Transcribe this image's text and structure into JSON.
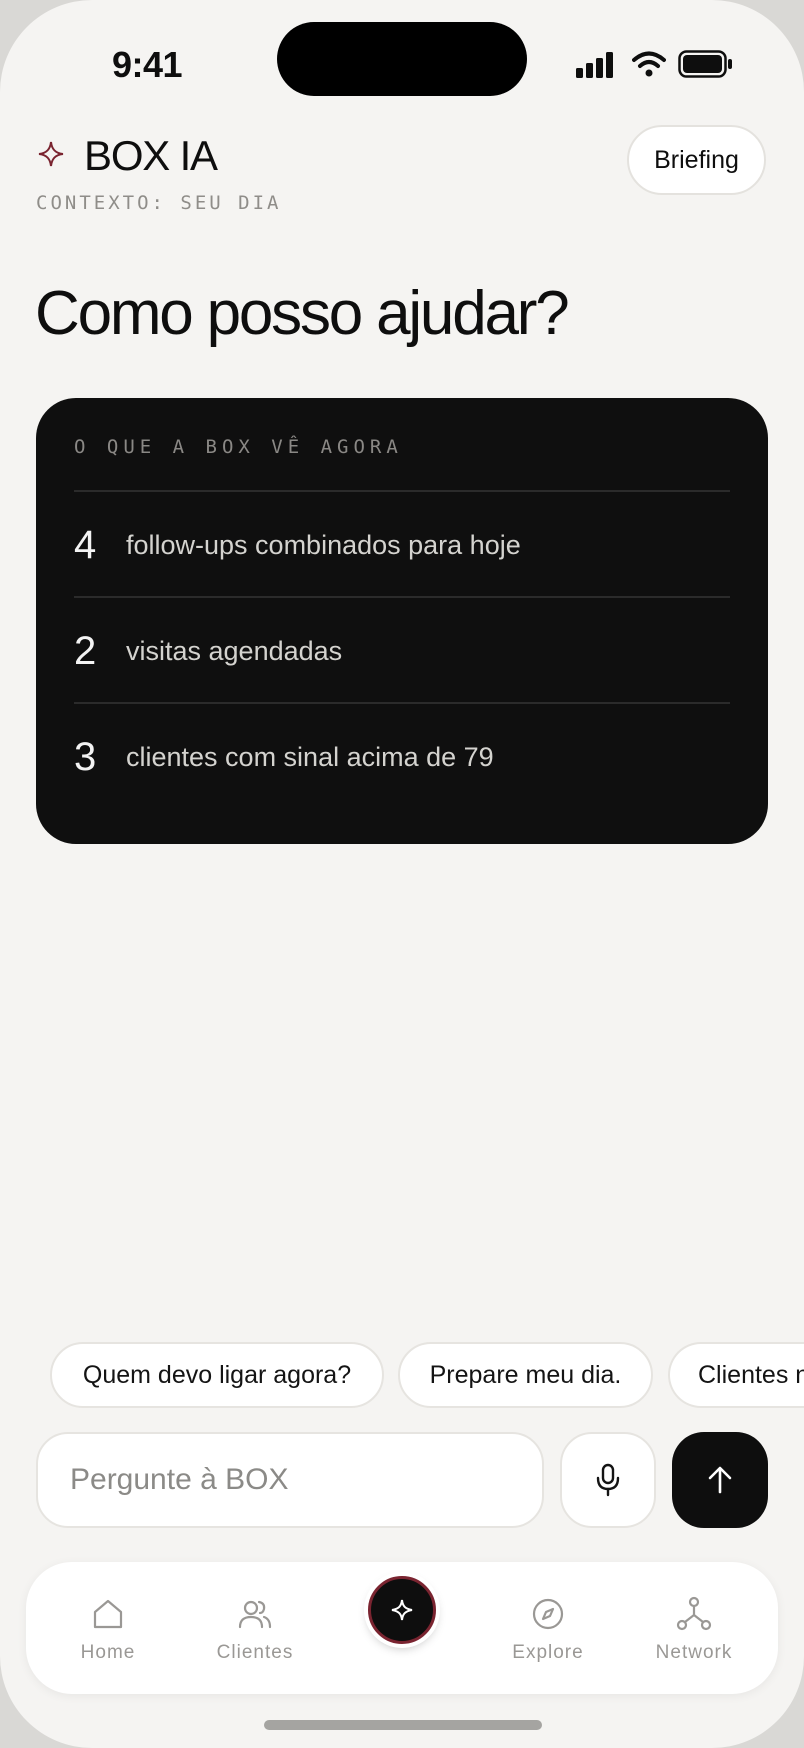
{
  "status_bar": {
    "time": "9:41"
  },
  "header": {
    "title": "BOX IA",
    "context": "CONTEXTO: SEU DIA",
    "briefing_label": "Briefing"
  },
  "headline": "Como posso ajudar?",
  "card": {
    "title": "O QUE A BOX VÊ AGORA",
    "rows": [
      {
        "number": "4",
        "text": "follow-ups combinados para hoje"
      },
      {
        "number": "2",
        "text": "visitas agendadas"
      },
      {
        "number": "3",
        "text": "clientes com sinal acima de 79"
      }
    ]
  },
  "suggestions": [
    "Quem devo ligar agora?",
    "Prepare meu dia.",
    "Clientes n"
  ],
  "composer": {
    "placeholder": "Pergunte à BOX"
  },
  "tabbar": {
    "items": [
      {
        "label": "Home",
        "icon": "home-icon"
      },
      {
        "label": "Clientes",
        "icon": "users-icon"
      },
      {
        "label": "",
        "icon": "sparkle-icon"
      },
      {
        "label": "Explore",
        "icon": "compass-icon"
      },
      {
        "label": "Network",
        "icon": "network-icon"
      }
    ]
  },
  "colors": {
    "background": "#f5f4f2",
    "card": "#0f0f0f",
    "accent": "#7a2430",
    "text": "#0e0e0e",
    "muted": "#8f8d89"
  }
}
